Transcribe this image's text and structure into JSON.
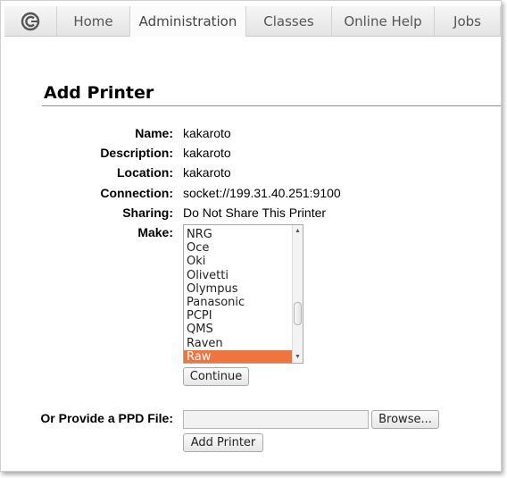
{
  "tabs": {
    "home": "Home",
    "administration": "Administration",
    "classes": "Classes",
    "online_help": "Online Help",
    "jobs": "Jobs"
  },
  "page": {
    "title": "Add Printer"
  },
  "form": {
    "name_label": "Name:",
    "name_value": "kakaroto",
    "description_label": "Description:",
    "description_value": "kakaroto",
    "location_label": "Location:",
    "location_value": "kakaroto",
    "connection_label": "Connection:",
    "connection_value": "socket://199.31.40.251:9100",
    "sharing_label": "Sharing:",
    "sharing_value": "Do Not Share This Printer",
    "make_label": "Make:",
    "make_options": [
      "NRG",
      "Oce",
      "Oki",
      "Olivetti",
      "Olympus",
      "Panasonic",
      "PCPI",
      "QMS",
      "Raven",
      "Raw"
    ],
    "make_selected": "Raw",
    "continue_button": "Continue",
    "ppd_label": "Or Provide a PPD File:",
    "ppd_value": "",
    "browse_button": "Browse...",
    "add_printer_button": "Add Printer"
  },
  "colors": {
    "selected_item_bg": "#ee7540"
  },
  "icons": {
    "logo": "cups-logo-icon"
  }
}
